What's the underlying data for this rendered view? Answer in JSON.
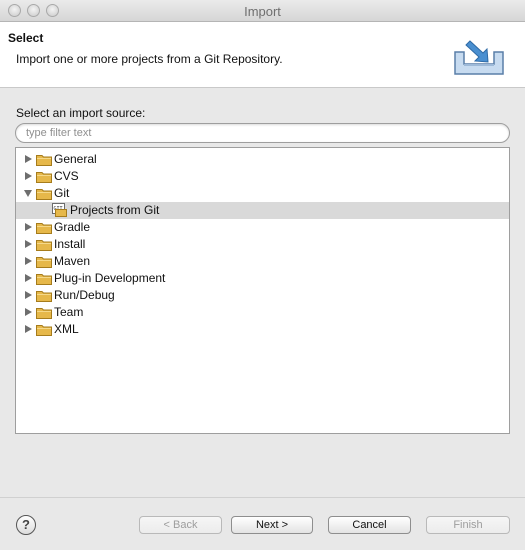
{
  "window": {
    "title": "Import"
  },
  "header": {
    "title": "Select",
    "description": "Import one or more projects from a Git Repository."
  },
  "source": {
    "label": "Select an import source:",
    "filter_placeholder": "type filter text"
  },
  "tree": {
    "items": [
      {
        "label": "General",
        "expanded": false
      },
      {
        "label": "CVS",
        "expanded": false
      },
      {
        "label": "Git",
        "expanded": true
      },
      {
        "label": "Projects from Git",
        "child": true,
        "selected": true
      },
      {
        "label": "Gradle",
        "expanded": false
      },
      {
        "label": "Install",
        "expanded": false
      },
      {
        "label": "Maven",
        "expanded": false
      },
      {
        "label": "Plug-in Development",
        "expanded": false
      },
      {
        "label": "Run/Debug",
        "expanded": false
      },
      {
        "label": "Team",
        "expanded": false
      },
      {
        "label": "XML",
        "expanded": false
      }
    ]
  },
  "footer": {
    "help": "?",
    "back_label": "< Back",
    "next_label": "Next >",
    "cancel_label": "Cancel",
    "finish_label": "Finish"
  },
  "colors": {
    "selection": "#d9d9d9",
    "folder": "#e6b84a"
  },
  "icons": {
    "folder": "folder-icon",
    "git_project": "git-projects-icon",
    "import_wizard": "import-wizard-icon"
  }
}
